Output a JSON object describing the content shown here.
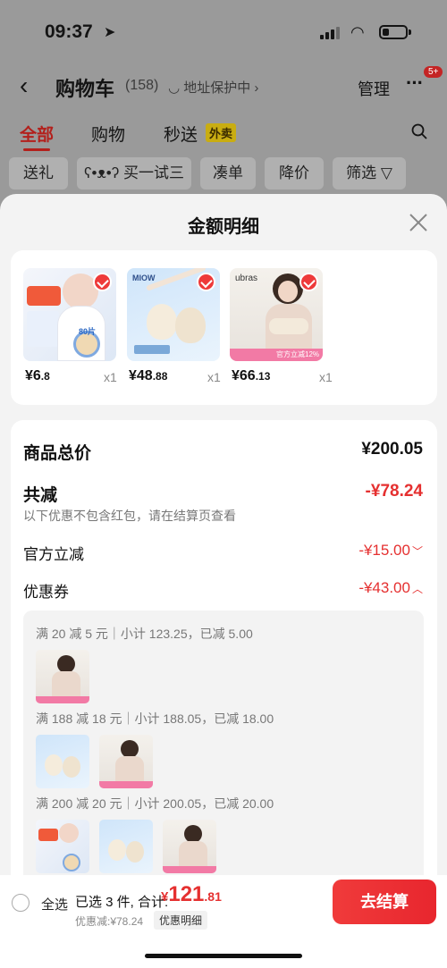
{
  "status": {
    "time": "09:37"
  },
  "nav": {
    "title": "购物车",
    "count": "(158)",
    "address": "◡ 地址保护中 ›",
    "manage": "管理",
    "badge": "5+"
  },
  "tabs": [
    {
      "label": "全部"
    },
    {
      "label": "购物"
    },
    {
      "label": "秒送"
    }
  ],
  "waimai_badge": "外卖",
  "chips": [
    "送礼",
    "买一试三",
    "凑单",
    "降价",
    "筛选"
  ],
  "sheet": {
    "title": "金额明细"
  },
  "products": [
    {
      "price_int": "¥6",
      "price_dec": ".8",
      "qty": "x1",
      "brand": "",
      "tag": "80片"
    },
    {
      "price_int": "¥48",
      "price_dec": ".88",
      "qty": "x1",
      "brand": "MIOW",
      "tag": ""
    },
    {
      "price_int": "¥66",
      "price_dec": ".13",
      "qty": "x1",
      "brand": "ubras",
      "tag": "官方立减12%"
    }
  ],
  "summary": {
    "total_label": "商品总价",
    "total_value": "¥200.05",
    "discount_label": "共减",
    "discount_value": "-¥78.24",
    "note": "以下优惠不包含红包，请在结算页查看",
    "official_label": "官方立减",
    "official_value": "-¥15.00",
    "coupon_label": "优惠券",
    "coupon_value": "-¥43.00"
  },
  "coupon_groups": [
    {
      "text": "满 20 减 5 元｜小计 123.25，已减 5.00"
    },
    {
      "text": "满 188 减 18 元｜小计 188.05，已减 18.00"
    },
    {
      "text": "满 200 减 20 元｜小计 200.05，已减 20.00"
    }
  ],
  "bottom": {
    "select_all": "全选",
    "selected": "已选 3 件, 合计:",
    "currency": "¥",
    "total_int": "121",
    "total_dec": ".81",
    "saved": "优惠减:¥78.24",
    "detail_link": "优惠明细",
    "checkout": "去结算"
  },
  "colors": {
    "accent": "#e53030",
    "sheet_bg": "#f3f3f3",
    "overlay": "#7f7f7f"
  }
}
